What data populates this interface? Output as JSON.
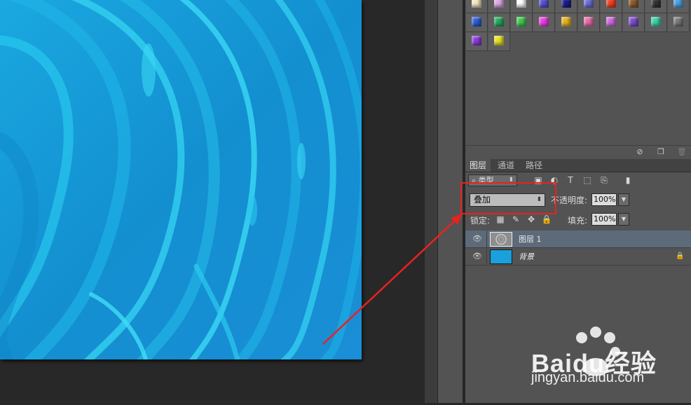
{
  "layers_panel": {
    "tabs": [
      "图层",
      "通道",
      "路径"
    ],
    "active_tab": 0,
    "filter_kind": "类型",
    "blend_mode": "叠加",
    "opacity_label": "不透明度:",
    "opacity_value": "100%",
    "lock_label": "锁定:",
    "fill_label": "填充:",
    "fill_value": "100%",
    "layers": [
      {
        "name": "图层 1",
        "selected": true,
        "visible": true,
        "locked": false
      },
      {
        "name": "背景",
        "selected": false,
        "visible": true,
        "locked": true
      }
    ]
  },
  "icons": {
    "eye": "eye-icon",
    "lock": "lock-icon",
    "type_filter": "type-filter-icon",
    "pixel_filter": "pixel-filter-icon",
    "adjustment_filter": "adjustment-filter-icon",
    "shape_filter": "shape-filter-icon",
    "smart_object_filter": "smart-object-filter-icon",
    "filter_toggle": "filter-toggle-icon",
    "no_style": "no-style-icon",
    "new_style": "new-style-icon",
    "trash": "trash-icon"
  },
  "styles_swatches": [
    [
      "#f6e8c0",
      "#e0a6e8",
      "#ffffff",
      "#5a4fd0",
      "#1b1b8a",
      "#6d6dd8",
      "#f04020",
      "#8b5a2b",
      "#333333",
      "#4aa0e0"
    ],
    [
      "#2a5bd8",
      "#22a85a",
      "#3cc84a",
      "#e83ce0",
      "#e8b020",
      "#e868a8",
      "#c86ad8",
      "#7a4ad0",
      "#3ad0a8",
      "#777777"
    ],
    [
      "#8a3ad8",
      "#e8e020"
    ]
  ],
  "colors": {
    "annotation_red": "#e8221e",
    "layer_selected": "#5d6a7a",
    "canvas_blue": "#1397d4",
    "canvas_highlight": "#29d0f0"
  },
  "watermark": {
    "brand": "Baidu经验",
    "url": "jingyan.baidu.com"
  }
}
